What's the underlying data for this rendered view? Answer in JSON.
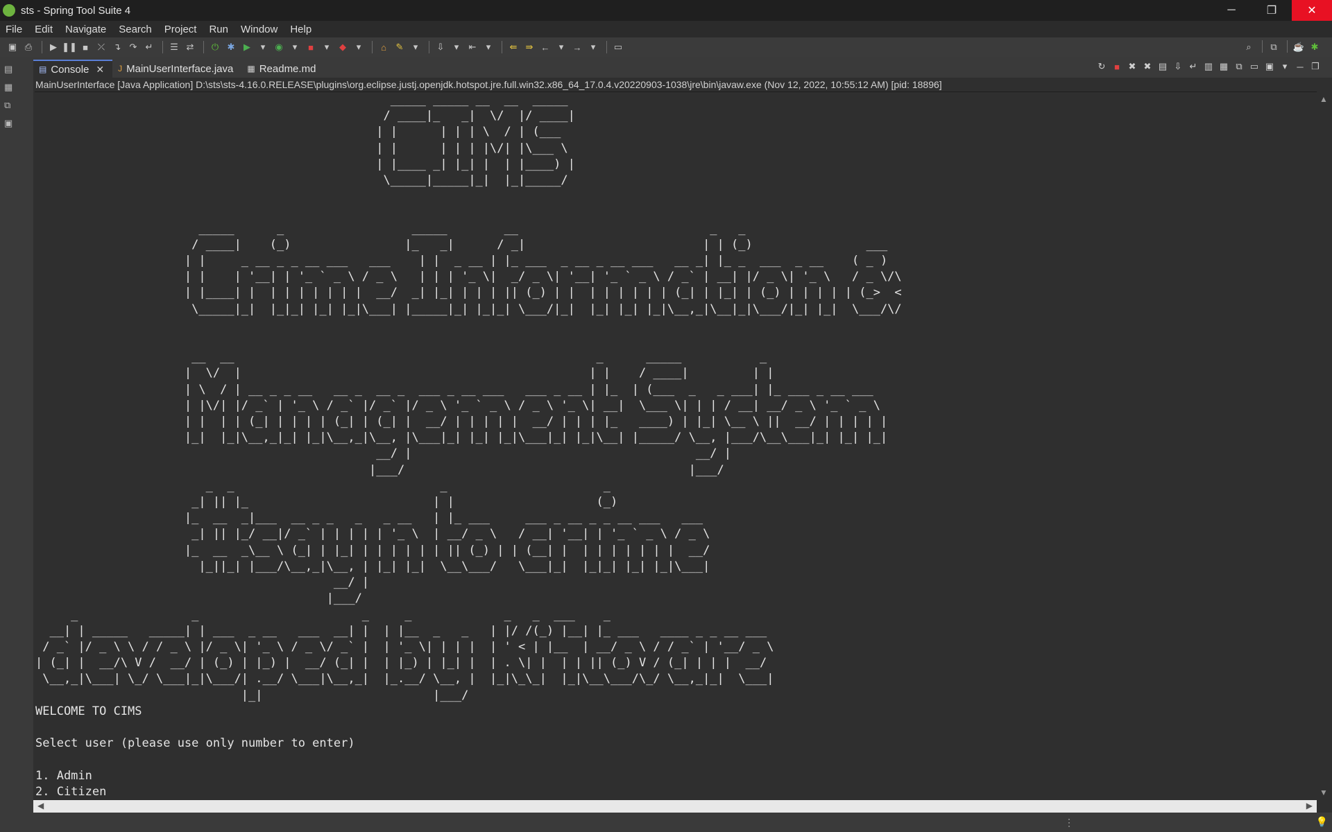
{
  "window": {
    "title": "sts - Spring Tool Suite 4",
    "controls": {
      "minimize": "─",
      "restore": "❐",
      "close": "✕"
    }
  },
  "menu": [
    "File",
    "Edit",
    "Navigate",
    "Search",
    "Project",
    "Run",
    "Window",
    "Help"
  ],
  "toolbar_icons": [
    "save-icon",
    "print-icon",
    "resume-icon",
    "suspend-icon",
    "terminate-icon",
    "disconnect-icon",
    "step-into-icon",
    "step-over-icon",
    "step-return-icon",
    "drop-to-frame-icon",
    "new-spring-starter-icon",
    "debug-icon",
    "run-icon",
    "coverage-icon",
    "stop-icon",
    "external-tools-icon",
    "open-type-icon",
    "search-icon",
    "annotation-icon",
    "back-icon",
    "forward-icon",
    "pin-editor-icon"
  ],
  "tabs": [
    {
      "label": "Console",
      "icon": "console-icon",
      "active": true
    },
    {
      "label": "MainUserInterface.java",
      "icon": "java-file-icon",
      "active": false
    },
    {
      "label": "Readme.md",
      "icon": "markdown-file-icon",
      "active": false
    }
  ],
  "console_header": "MainUserInterface [Java Application] D:\\sts\\sts-4.16.0.RELEASE\\plugins\\org.eclipse.justj.openjdk.hotspot.jre.full.win32.x86_64_17.0.4.v20220903-1038\\jre\\bin\\javaw.exe  (Nov 12, 2022, 10:55:12 AM) [pid: 18896]",
  "console": {
    "ascii_banner": "                                                  _____ _____ __  __  _____ \n                                                 / ____|_   _|  \\/  |/ ____|\n                                                | |      | | | \\  / | (___  \n                                                | |      | | | |\\/| |\\___ \\ \n                                                | |____ _| |_| |  | |____) |\n                                                 \\_____|_____|_|  |_|_____/ \n\n\n                       _____      _                  _____        __                           _   _                        \n                      / ____|    (_)                |_   _|      / _|                         | | (_)                ___   \n                     | |     _ __ _ _ __ ___   ___    | |  _ __ | |_ ___  _ __ _ __ ___   __ _| |_ _  ___  _ __    ( _ )  \n                     | |    | '__| | '_ ` _ \\ / _ \\   | | | '_ \\|  _/ _ \\| '__| '_ ` _ \\ / _` | __| |/ _ \\| '_ \\   / _ \\/\\\n                     | |____| |  | | | | | | |  __/  _| |_| | | | || (_) | |  | | | | | | (_| | |_| | (_) | | | | | (_>  <\n                      \\_____|_|  |_|_| |_| |_|\\___| |_____|_| |_|_| \\___/|_|  |_| |_| |_|\\__,_|\\__|_|\\___/|_| |_|  \\___/\\/\n\n\n                      __  __                                                   _      _____           _                 \n                     |  \\/  |                                                 | |    / ____|         | |                \n                     | \\  / | __ _ _ __   __ _  __ _  ___ _ __ ___   ___ _ __ | |_  | (___  _   _ ___| |_ ___ _ __ ___  \n                     | |\\/| |/ _` | '_ \\ / _` |/ _` |/ _ \\ '_ ` _ \\ / _ \\ '_ \\| __|  \\___ \\| | | / __| __/ _ \\ '_ ` _ \\ \n                     | |  | | (_| | | | | (_| | (_| |  __/ | | | | |  __/ | | | |_   ____) | |_| \\__ \\ ||  __/ | | | | |\n                     |_|  |_|\\__,_|_| |_|\\__,_|\\__, |\\___|_| |_| |_|\\___|_| |_|\\__| |_____/ \\__, |___/\\__\\___|_| |_| |_|\n                                                __/ |                                        __/ |                      \n                                               |___/                                        |___/                       \n                        _  _                             _                      _                \n                      _| || |_                          | |                    (_)               \n                     |_  __  _|___  __ _ _   _   _ __   | |_ ___     ___ _ __ _ _ __ ___   ___ \n                      _| || |_/ __|/ _` | | | | | '_ \\  | __/ _ \\   / __| '__| | '_ ` _ \\ / _ \\\n                     |_  __  _\\__ \\ (_| | |_| | | | | | | || (_) | | (__| |  | | | | | | |  __/\n                       |_||_| |___/\\__,_|\\__, | |_| |_|  \\__\\___/   \\___|_|  |_|_| |_| |_|\\___|\n                                          __/ |                                                \n                                         |___/                                                 \n     _                _                       _     _             _   _  ___    _                        \n  __| | _____   _____| | ___  _ __   ___  __| |  | |__  _   _   | |/ /(_) |__| |_ ___   ____ _ _ __ ___ \n / _` |/ _ \\ \\ / / _ \\ |/ _ \\| '_ \\ / _ \\/ _` |  | '_ \\| | | |  | ' < | |__  | __/ _ \\ / / _` | '__/ _ \\\n| (_| |  __/\\ V /  __/ | (_) | |_) |  __/ (_| |  | |_) | |_| |  | . \\| |  | | || (_) V / (_| | | |  __/\n \\__,_|\\___| \\_/ \\___|_|\\___/| .__/ \\___|\\__,_|  |_.__/ \\__, |  |_|\\_\\_|  |_|\\__\\___/\\_/ \\__,_|_|  \\___|\n                             |_|                        |___/                                             ",
    "welcome": "WELCOME TO CIMS",
    "prompt": "Select user (please use only number to enter)",
    "options": [
      "1. Admin",
      "2. Citizen"
    ]
  }
}
